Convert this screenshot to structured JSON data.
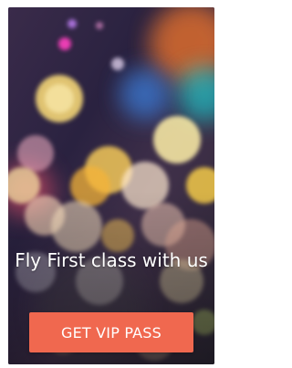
{
  "promo": {
    "headline": "Fly First class with us",
    "cta_label": "GET VIP PASS",
    "background_image": "city-lights-bokeh",
    "colors": {
      "cta_background": "#f0684f",
      "text": "#ffffff"
    }
  }
}
